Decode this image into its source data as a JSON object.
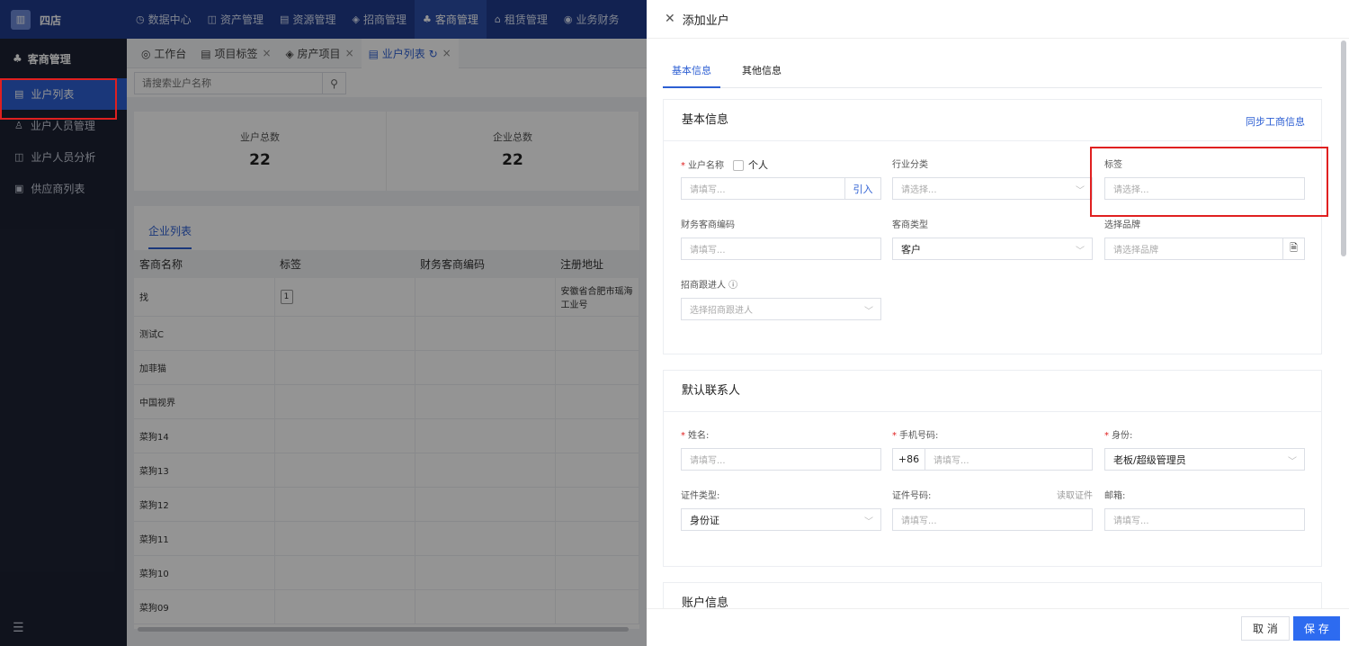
{
  "app": {
    "logo_icon": "building-icon",
    "logo_glyph": "▥",
    "brand": "四店"
  },
  "topnav": [
    {
      "icon": "◷",
      "label": "数据中心"
    },
    {
      "icon": "◫",
      "label": "资产管理"
    },
    {
      "icon": "▤",
      "label": "资源管理"
    },
    {
      "icon": "◈",
      "label": "招商管理"
    },
    {
      "icon": "♣",
      "label": "客商管理"
    },
    {
      "icon": "⌂",
      "label": "租赁管理"
    },
    {
      "icon": "◉",
      "label": "业务财务"
    }
  ],
  "sidebar": {
    "head": {
      "icon": "♣",
      "label": "客商管理"
    },
    "items": [
      {
        "icon": "▤",
        "label": "业户列表"
      },
      {
        "icon": "♙",
        "label": "业户人员管理"
      },
      {
        "icon": "◫",
        "label": "业户人员分析"
      },
      {
        "icon": "▣",
        "label": "供应商列表"
      }
    ],
    "collapse_glyph": "☰"
  },
  "tabs": [
    {
      "label": "◎ 工作台",
      "close": ""
    },
    {
      "label": "▤ 项目标签",
      "close": "×"
    },
    {
      "label": "◈ 房产项目",
      "close": "×"
    },
    {
      "label": "▤ 业户列表 ↻",
      "close": "×"
    }
  ],
  "search": {
    "placeholder": "请搜索业户名称",
    "icon": "⚲"
  },
  "stats": [
    {
      "label": "业户总数",
      "value": "22"
    },
    {
      "label": "企业总数",
      "value": "22"
    }
  ],
  "list": {
    "tab_label": "企业列表",
    "columns": [
      "客商名称",
      "标签",
      "财务客商编码",
      "注册地址"
    ],
    "rows": [
      {
        "name": "找",
        "tag": "1",
        "code": "",
        "address": "安徽省合肥市瑶海工业号"
      },
      {
        "name": "测试C",
        "tag": "",
        "code": "",
        "address": ""
      },
      {
        "name": "加菲猫",
        "tag": "",
        "code": "",
        "address": ""
      },
      {
        "name": "中国视界",
        "tag": "",
        "code": "",
        "address": ""
      },
      {
        "name": "菜狗14",
        "tag": "",
        "code": "",
        "address": ""
      },
      {
        "name": "菜狗13",
        "tag": "",
        "code": "",
        "address": ""
      },
      {
        "name": "菜狗12",
        "tag": "",
        "code": "",
        "address": ""
      },
      {
        "name": "菜狗11",
        "tag": "",
        "code": "",
        "address": ""
      },
      {
        "name": "菜狗10",
        "tag": "",
        "code": "",
        "address": ""
      },
      {
        "name": "菜狗09",
        "tag": "",
        "code": "",
        "address": ""
      }
    ]
  },
  "drawer": {
    "close_glyph": "✕",
    "title": "添加业户",
    "tabs": [
      "基本信息",
      "其他信息"
    ],
    "basic": {
      "title": "基本信息",
      "sync_link": "同步工商信息",
      "name_label": "业户名称",
      "individual_label": "个人",
      "name_placeholder": "请填写...",
      "import_btn": "引入",
      "industry_label": "行业分类",
      "industry_placeholder": "请选择...",
      "tag_label": "标签",
      "tag_placeholder": "请选择...",
      "fincode_label": "财务客商编码",
      "fincode_placeholder": "请填写...",
      "type_label": "客商类型",
      "type_value": "客户",
      "brand_label": "选择品牌",
      "brand_placeholder": "请选择品牌",
      "follower_label": "招商跟进人 ⓘ",
      "follower_placeholder": "选择招商跟进人"
    },
    "contact": {
      "title": "默认联系人",
      "name_label": "姓名:",
      "name_placeholder": "请填写...",
      "phone_label": "手机号码:",
      "phone_prefix": "+86",
      "phone_placeholder": "请填写...",
      "role_label": "身份:",
      "role_value": "老板/超级管理员",
      "idtype_label": "证件类型:",
      "idtype_value": "身份证",
      "idno_label": "证件号码:",
      "read_id": "读取证件",
      "idno_placeholder": "请填写...",
      "email_label": "邮箱:",
      "email_placeholder": "请填写..."
    },
    "account": {
      "title": "账户信息"
    },
    "chevron": "﹀",
    "brand_icon": "🗎",
    "footer": {
      "cancel": "取 消",
      "save": "保 存"
    }
  }
}
